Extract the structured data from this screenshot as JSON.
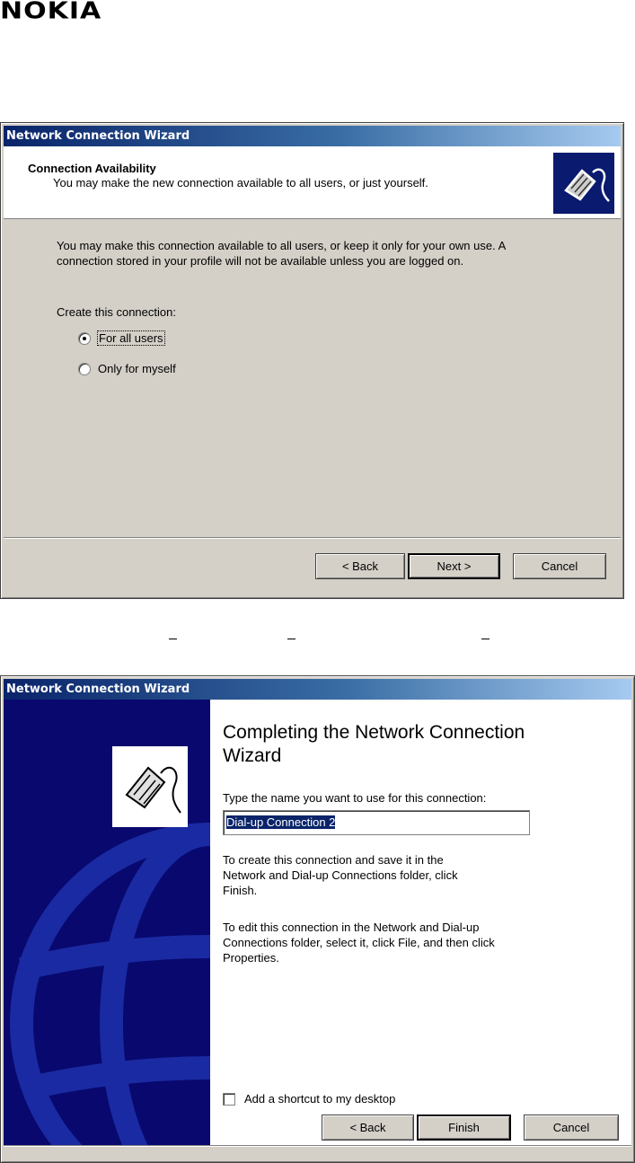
{
  "logo": "NOKIA",
  "colors": {
    "dialog_bg": "#d4d0c8",
    "titlebar": "#0a246a",
    "wizard_panel": "#08086e"
  },
  "dialog1": {
    "title": "Network Connection Wizard",
    "header_title": "Connection Availability",
    "header_subtitle": "You may make the new connection available to all users, or just yourself.",
    "header_icon": "network-plug-icon",
    "description_line1": "You may make this connection available to all users, or keep it only for your own use.  A",
    "description_line2": "connection stored in your profile will not be available unless you are logged on.",
    "create_label": "Create this connection:",
    "options": [
      {
        "label": "For all users",
        "selected": true
      },
      {
        "label": "Only for myself",
        "selected": false
      }
    ],
    "back_label": "< Back",
    "next_label": "Next >",
    "cancel_label": "Cancel"
  },
  "dialog2": {
    "title": "Network Connection Wizard",
    "heading_line1": "Completing the Network Connection",
    "heading_line2": "Wizard",
    "prompt": "Type the name you want to use for this connection:",
    "connection_name": "Dial-up Connection 2",
    "save_line1": "To create this connection and save it in the",
    "save_line2": "Network and Dial-up Connections folder, click",
    "save_line3": "Finish.",
    "edit_line1": "To edit this connection in the Network and Dial-up",
    "edit_line2": "Connections folder, select it, click File, and then click",
    "edit_line3": "Properties.",
    "shortcut_label": "Add a shortcut to my desktop",
    "shortcut_checked": false,
    "back_label": "< Back",
    "finish_label": "Finish",
    "cancel_label": "Cancel"
  }
}
